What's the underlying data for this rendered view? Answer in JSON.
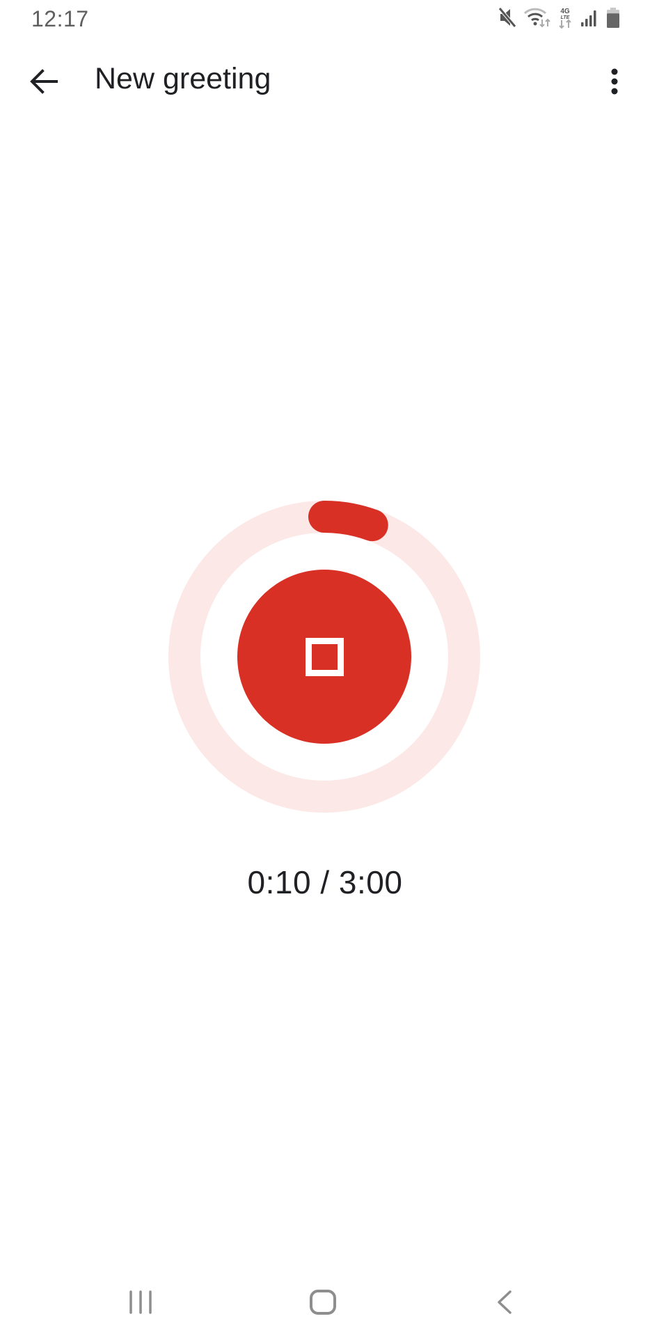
{
  "status_bar": {
    "time": "12:17",
    "icons": [
      "mute-icon",
      "wifi-icon",
      "4g-lte-icon",
      "signal-icon",
      "battery-icon"
    ],
    "network_label_top": "4G",
    "network_label_bottom": "LTE",
    "battery_level_fraction": 0.8
  },
  "app_bar": {
    "back_icon": "arrow-back-icon",
    "title": "New greeting",
    "more_icon": "more-vert-icon"
  },
  "recorder": {
    "elapsed": "0:10",
    "total": "3:00",
    "elapsed_seconds": 10,
    "total_seconds": 180,
    "progress_fraction": 0.0556,
    "timer_text": "0:10 / 3:00",
    "stop_icon": "stop-icon",
    "colors": {
      "accent": "#d93025",
      "track": "#fce8e6"
    }
  },
  "nav_bar": {
    "recents_icon": "recents-icon",
    "home_icon": "home-icon",
    "back_icon": "nav-back-icon"
  }
}
